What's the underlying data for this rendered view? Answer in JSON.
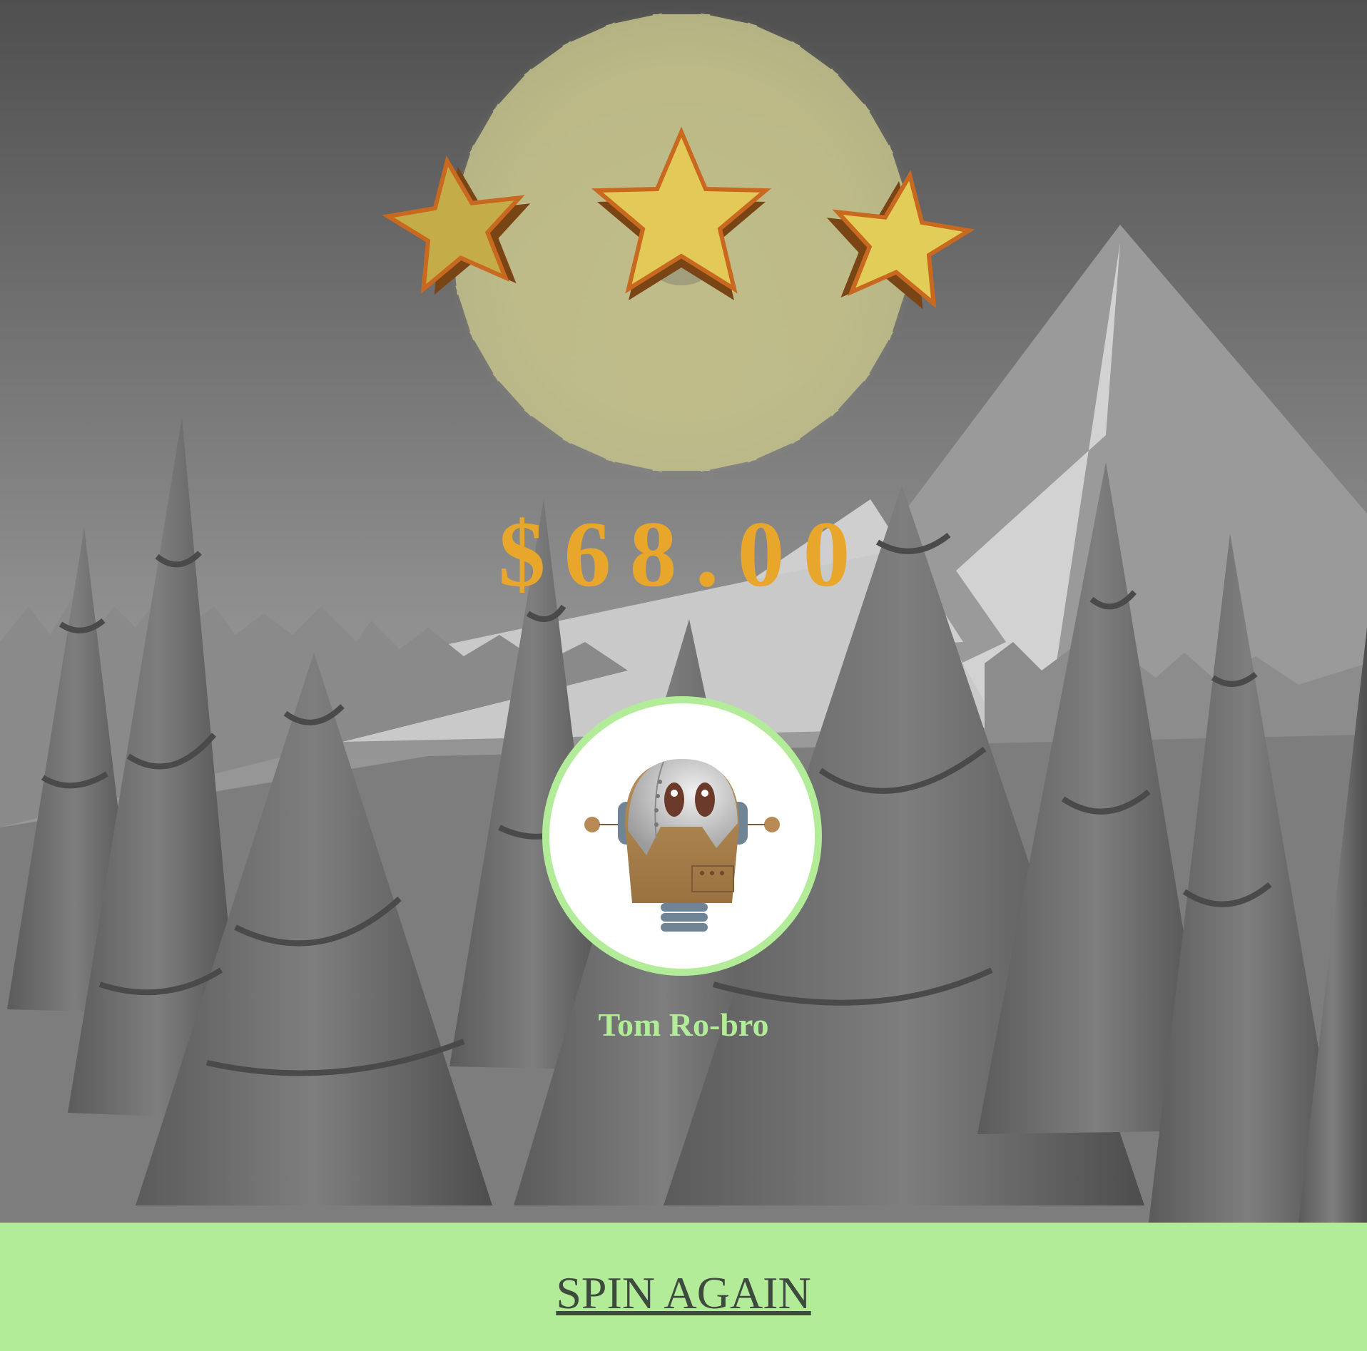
{
  "result": {
    "stars_earned": 3,
    "stars_total": 3,
    "prize_amount": "$68.00"
  },
  "character": {
    "name": "Tom Ro-bro",
    "avatar_icon": "robot-avatar-icon",
    "frame_color": "#b3ec98"
  },
  "actions": {
    "spin_again_label": "SPIN AGAIN"
  },
  "colors": {
    "accent_green": "#b3ec98",
    "prize_gold": "#e8a72a",
    "star_fill": "#e3c957",
    "star_edge": "#c8691f"
  }
}
